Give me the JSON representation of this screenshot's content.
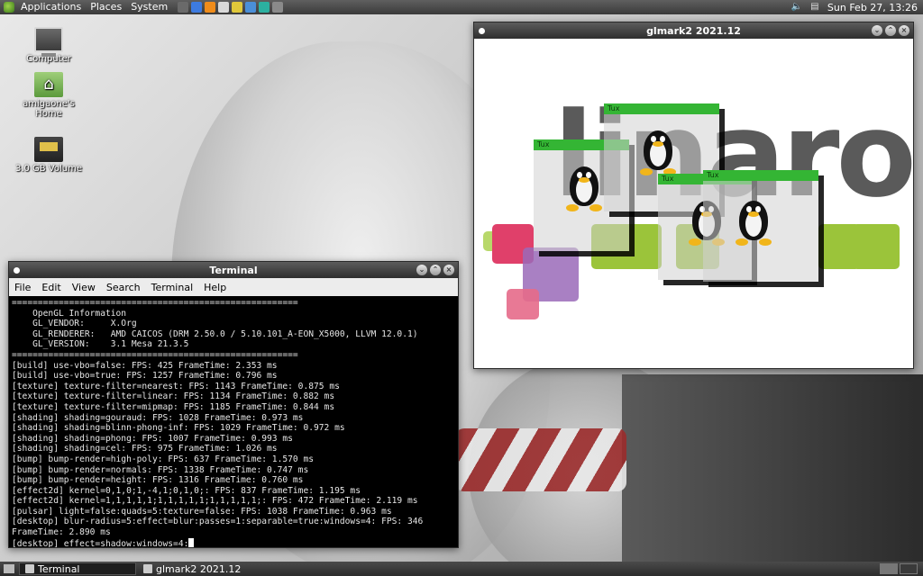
{
  "top_panel": {
    "menus": [
      "Applications",
      "Places",
      "System"
    ],
    "launchers": [
      {
        "name": "terminal-launcher-icon",
        "color": "#6a6a6a"
      },
      {
        "name": "browser-launcher-icon",
        "color": "#3d7be0"
      },
      {
        "name": "vlc-launcher-icon",
        "color": "#f08c1a"
      },
      {
        "name": "mail-launcher-icon",
        "color": "#d9d9d9"
      },
      {
        "name": "chrome-launcher-icon",
        "color": "#e0c83a"
      },
      {
        "name": "settings-launcher-icon",
        "color": "#4a8fd8"
      },
      {
        "name": "network-launcher-icon",
        "color": "#2bb0a0"
      },
      {
        "name": "photo-launcher-icon",
        "color": "#8a8a8a"
      }
    ],
    "clock": "Sun Feb 27, 13:26"
  },
  "desktop_icons": [
    {
      "label": "Computer",
      "glyph": "computer-icon"
    },
    {
      "label": "amigaone's Home",
      "glyph": "home-folder-icon"
    },
    {
      "label": "3.0 GB Volume",
      "glyph": "drive-icon"
    }
  ],
  "terminal": {
    "title": "Terminal",
    "menus": [
      "File",
      "Edit",
      "View",
      "Search",
      "Terminal",
      "Help"
    ],
    "lines": [
      "=======================================================",
      "    OpenGL Information",
      "    GL_VENDOR:     X.Org",
      "    GL_RENDERER:   AMD CAICOS (DRM 2.50.0 / 5.10.101_A-EON_X5000, LLVM 12.0.1)",
      "    GL_VERSION:    3.1 Mesa 21.3.5",
      "=======================================================",
      "[build] use-vbo=false: FPS: 425 FrameTime: 2.353 ms",
      "[build] use-vbo=true: FPS: 1257 FrameTime: 0.796 ms",
      "[texture] texture-filter=nearest: FPS: 1143 FrameTime: 0.875 ms",
      "[texture] texture-filter=linear: FPS: 1134 FrameTime: 0.882 ms",
      "[texture] texture-filter=mipmap: FPS: 1185 FrameTime: 0.844 ms",
      "[shading] shading=gouraud: FPS: 1028 FrameTime: 0.973 ms",
      "[shading] shading=blinn-phong-inf: FPS: 1029 FrameTime: 0.972 ms",
      "[shading] shading=phong: FPS: 1007 FrameTime: 0.993 ms",
      "[shading] shading=cel: FPS: 975 FrameTime: 1.026 ms",
      "[bump] bump-render=high-poly: FPS: 637 FrameTime: 1.570 ms",
      "[bump] bump-render=normals: FPS: 1338 FrameTime: 0.747 ms",
      "[bump] bump-render=height: FPS: 1316 FrameTime: 0.760 ms",
      "[effect2d] kernel=0,1,0;1,-4,1;0,1,0;: FPS: 837 FrameTime: 1.195 ms",
      "[effect2d] kernel=1,1,1,1,1;1,1,1,1,1;1,1,1,1,1;: FPS: 472 FrameTime: 2.119 ms",
      "[pulsar] light=false:quads=5:texture=false: FPS: 1038 FrameTime: 0.963 ms",
      "[desktop] blur-radius=5:effect=blur:passes=1:separable=true:windows=4: FPS: 346",
      "FrameTime: 2.890 ms"
    ],
    "prompt_line": "[desktop] effect=shadow:windows=4:"
  },
  "glmark": {
    "title": "glmark2 2021.12",
    "logo_text": "linaro",
    "tux_label": "Tux",
    "colors": {
      "green": "#9bc43a",
      "pink": "#e0406a",
      "purple": "#8a5aa8",
      "gray": "#5a5a5a"
    }
  },
  "taskbar": {
    "tasks": [
      "Terminal",
      "glmark2 2021.12"
    ]
  }
}
